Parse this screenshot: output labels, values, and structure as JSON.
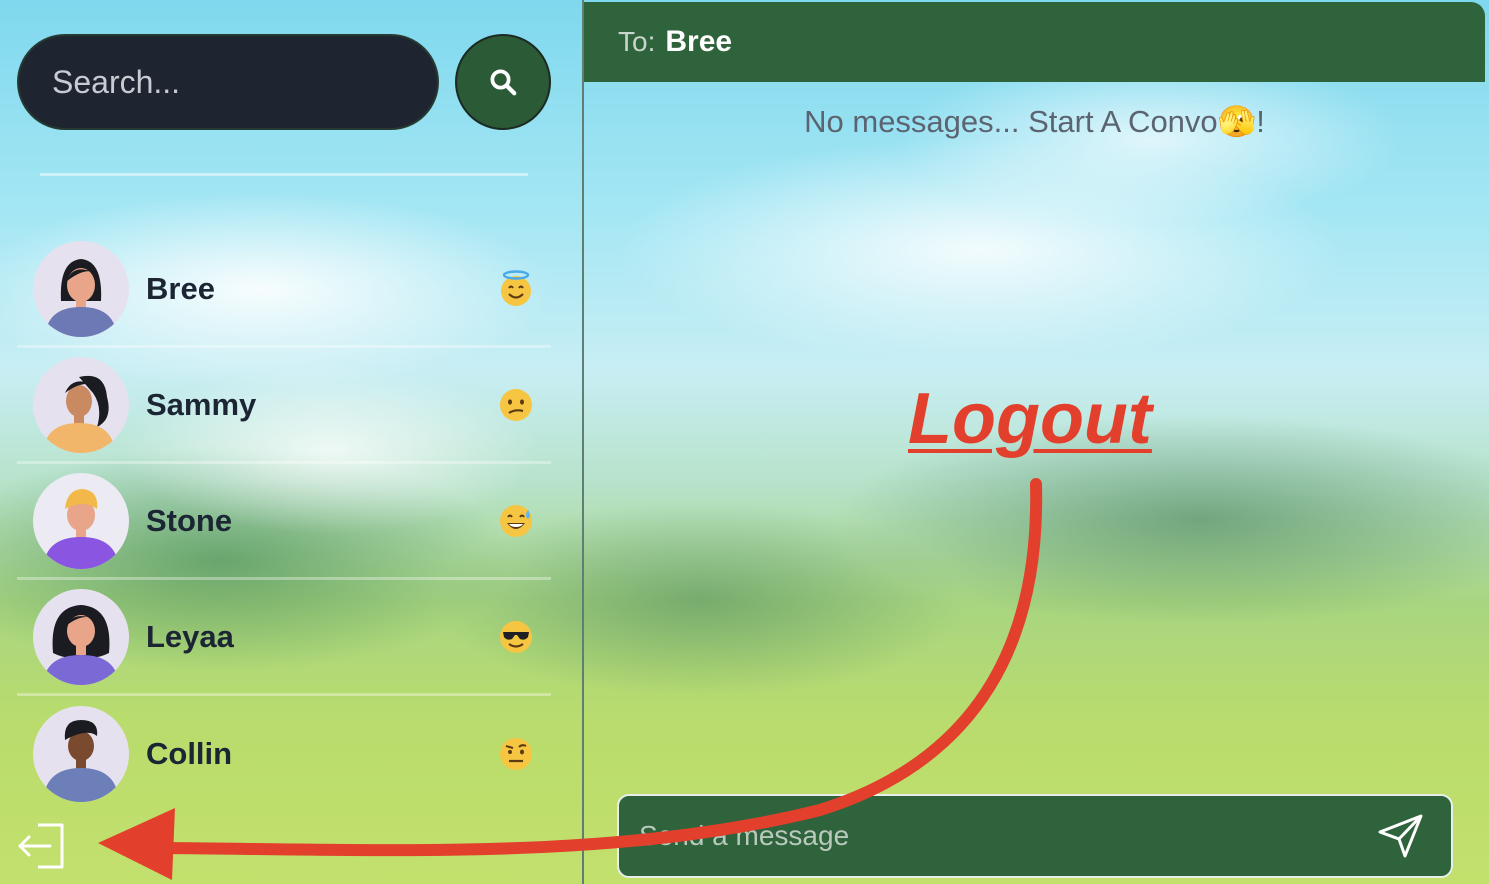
{
  "search": {
    "placeholder": "Search..."
  },
  "contacts": [
    {
      "name": "Bree",
      "mood_icon": "halo-smile-emoji"
    },
    {
      "name": "Sammy",
      "mood_icon": "confused-face-emoji"
    },
    {
      "name": "Stone",
      "mood_icon": "sweat-smile-emoji"
    },
    {
      "name": "Leyaa",
      "mood_icon": "sunglasses-face-emoji"
    },
    {
      "name": "Collin",
      "mood_icon": "raised-eyebrow-emoji"
    }
  ],
  "chat": {
    "to_label": "To:",
    "recipient": "Bree",
    "empty_message": "No messages... Start A Convo🫣!"
  },
  "message_bar": {
    "placeholder": "Send a message"
  },
  "annotation": {
    "label": "Logout"
  },
  "colors": {
    "header_green": "#2e633b",
    "search_bg": "#1e2530",
    "annotation_red": "#e2402c",
    "name_text": "#1c2533"
  },
  "icons": {
    "search": "search-icon",
    "send": "send-icon",
    "logout": "logout-icon"
  }
}
